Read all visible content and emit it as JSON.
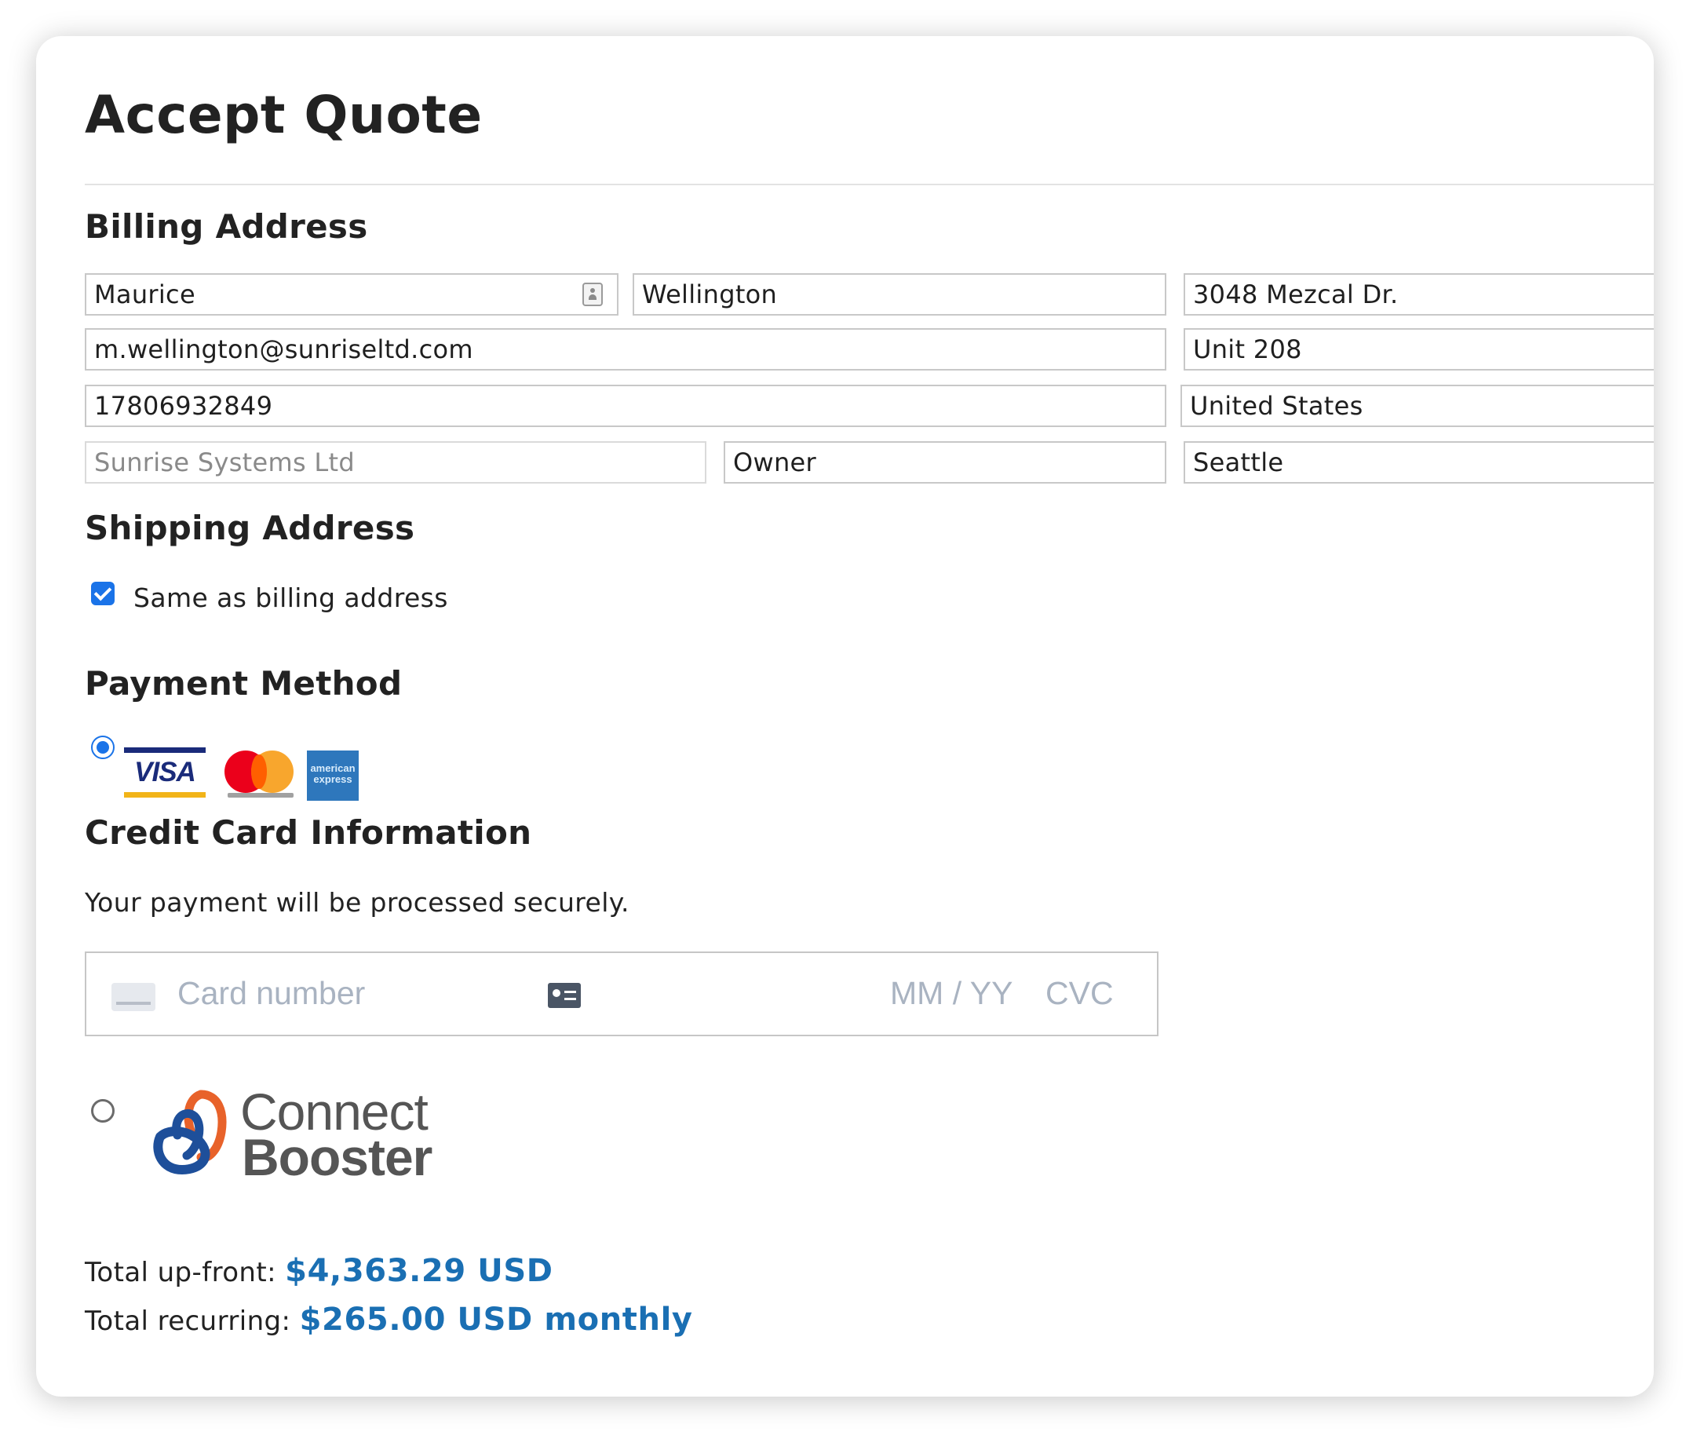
{
  "page": {
    "title": "Accept Quote"
  },
  "billing": {
    "heading": "Billing Address",
    "first_name": "Maurice",
    "last_name": "Wellington",
    "email": "m.wellington@sunriseltd.com",
    "phone": "17806932849",
    "company_placeholder": "Sunrise Systems Ltd",
    "job_title": "Owner",
    "address_line1": "3048 Mezcal Dr.",
    "address_line2": "Unit 208",
    "country": "United States",
    "city": "Seattle"
  },
  "shipping": {
    "heading": "Shipping Address",
    "same_as_billing_label": "Same as billing address",
    "same_as_billing_checked": true
  },
  "payment": {
    "heading": "Payment Method",
    "selected": "credit-card",
    "card_brands": [
      "VISA",
      "mastercard",
      "american express"
    ],
    "credit_card_heading": "Credit Card Information",
    "secure_note": "Your payment will be processed securely.",
    "card_number_placeholder": "Card number",
    "expiry_placeholder": "MM / YY",
    "cvc_placeholder": "CVC",
    "alt_provider_line1": "Connect",
    "alt_provider_line2": "Booster"
  },
  "totals": {
    "upfront_label": "Total up-front:",
    "upfront_amount": "$4,363.29 USD",
    "recurring_label": "Total recurring:",
    "recurring_amount": "$265.00 USD monthly",
    "accent_color": "#1a6fb3"
  },
  "colors": {
    "checkbox": "#1a73e8",
    "visa_blue": "#1a2b7a",
    "visa_gold": "#f2b418",
    "mastercard_red": "#eb001b",
    "mastercard_orange": "#f79e1b",
    "amex_blue": "#2e77bc",
    "connectbooster_blue": "#1e4f9a",
    "connectbooster_orange": "#e8622a"
  }
}
